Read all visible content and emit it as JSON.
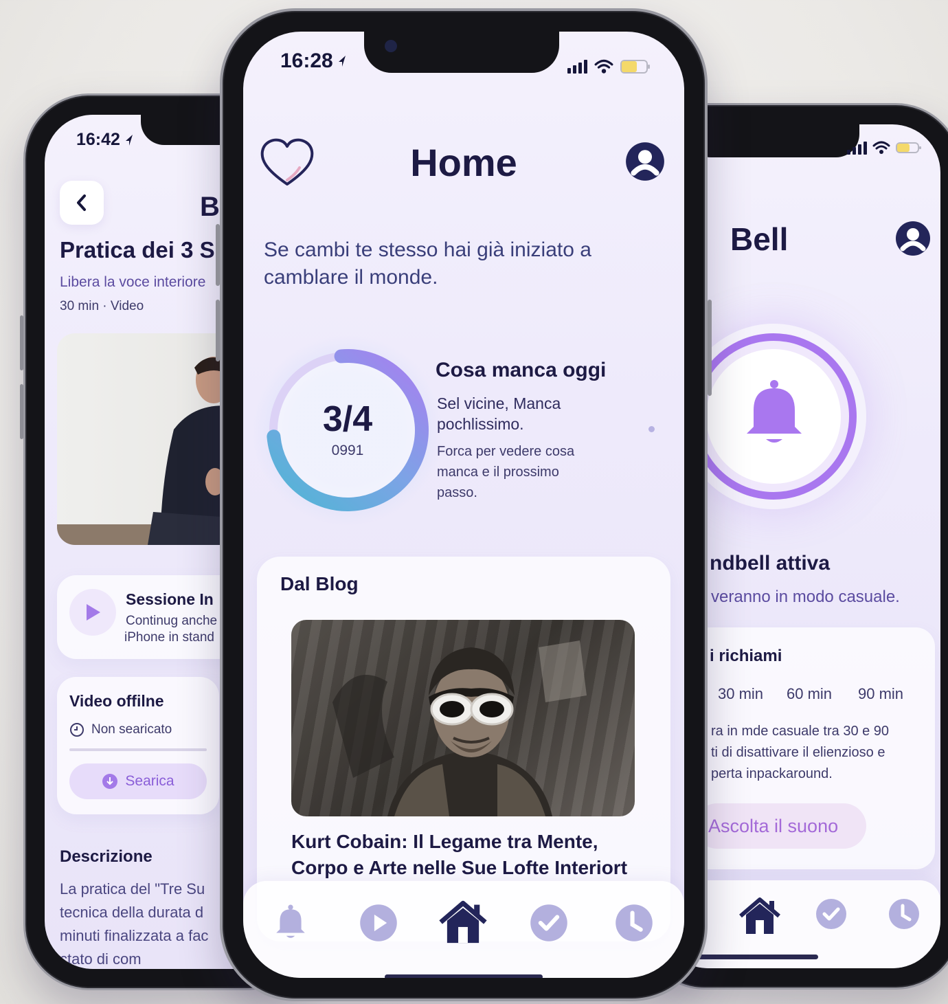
{
  "left": {
    "status_time": "16:42",
    "header_title_partial": "B",
    "practice_title": "Pratica dei 3 S",
    "subtitle": "Libera la voce interiore",
    "meta": "30 min · Video",
    "session": {
      "title": "Sessione In",
      "line1": "Continug anche",
      "line2": "iPhone in stand"
    },
    "offline": {
      "title": "Video offilne",
      "status": "Non searicato",
      "button": "Searica"
    },
    "description": {
      "title": "Descrizione",
      "lines": [
        "La pratica del \"Tre Su",
        "tecnica della durata d",
        "minuti finalizzata a fac",
        "ctato di com"
      ]
    }
  },
  "center": {
    "status_time": "16:28",
    "title": "Home",
    "quote": [
      "Se cambi te stesso hai già iniziato a",
      "camblare il monde."
    ],
    "progress": {
      "label": "3/4",
      "sub": "0991",
      "fraction": 0.75
    },
    "today": {
      "title": "Cosa manca oggi",
      "line1": "Sel vicine, Manca",
      "line2": "pochlissimo.",
      "line3": "Forca per vedere cosa",
      "line4": "manca e il prossimo",
      "line5": "passo."
    },
    "blog": {
      "heading": "Dal Blog",
      "article_title": [
        "Kurt Cobain: Il Legame tra Mente,",
        "Corpo e Arte nelle Sue Lofte Interiort"
      ]
    }
  },
  "right": {
    "title": "Bell",
    "active_title": "ndbell attiva",
    "active_sub": "veranno in modo casuale.",
    "reminders": {
      "title": "i richiami",
      "options": [
        "30 min",
        "60 min",
        "90 min"
      ],
      "desc": [
        "ra in mde casuale tra 30 e 90",
        "ti di disattivare il elienzioso e",
        "perta inpackaround."
      ],
      "button": "Ascolta il suono"
    }
  },
  "colors": {
    "accent": "#a37ae8",
    "navy": "#1d1a44",
    "ring_start": "#4fb6d4",
    "ring_end": "#a97ef0"
  }
}
